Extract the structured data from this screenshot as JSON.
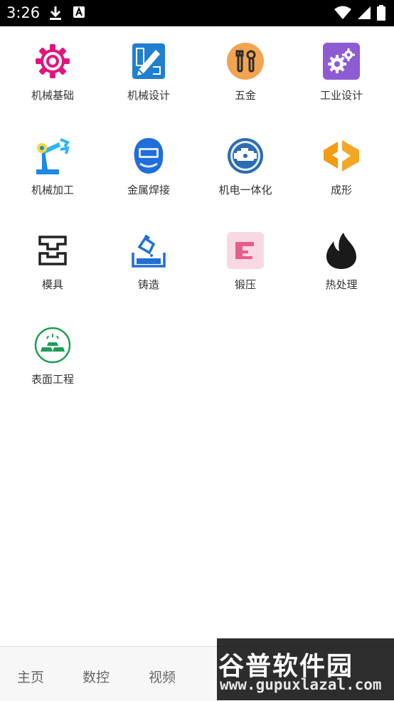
{
  "status": {
    "time": "3:26"
  },
  "categories": [
    {
      "label": "机械基础",
      "icon": "gear-icon"
    },
    {
      "label": "机械设计",
      "icon": "design-pencil-icon"
    },
    {
      "label": "五金",
      "icon": "wrench-icon"
    },
    {
      "label": "工业设计",
      "icon": "gears-icon"
    },
    {
      "label": "机械加工",
      "icon": "robot-arm-icon"
    },
    {
      "label": "金属焊接",
      "icon": "welding-mask-icon"
    },
    {
      "label": "机电一体化",
      "icon": "engine-icon"
    },
    {
      "label": "成形",
      "icon": "forming-icon"
    },
    {
      "label": "模具",
      "icon": "mold-icon"
    },
    {
      "label": "铸造",
      "icon": "casting-icon"
    },
    {
      "label": "锻压",
      "icon": "forging-press-icon"
    },
    {
      "label": "热处理",
      "icon": "flame-icon"
    },
    {
      "label": "表面工程",
      "icon": "gold-bars-icon"
    }
  ],
  "bottom_nav": [
    {
      "label": "主页"
    },
    {
      "label": "数控"
    },
    {
      "label": "视频"
    }
  ],
  "watermark": {
    "title": "谷普软件园",
    "url": "www.gupuxlazal.com"
  }
}
